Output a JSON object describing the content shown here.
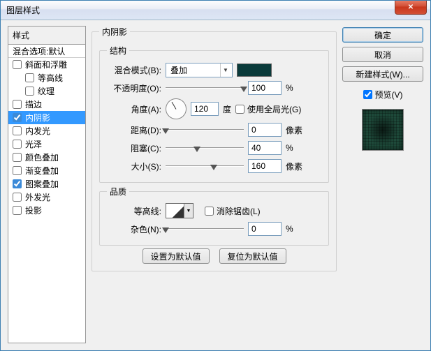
{
  "window": {
    "title": "图层样式",
    "close_glyph": "✕"
  },
  "left": {
    "header": "样式",
    "blend_default": "混合选项:默认",
    "items": [
      {
        "label": "斜面和浮雕",
        "checked": false,
        "indent": false
      },
      {
        "label": "等高线",
        "checked": false,
        "indent": true
      },
      {
        "label": "纹理",
        "checked": false,
        "indent": true
      },
      {
        "label": "描边",
        "checked": false,
        "indent": false
      },
      {
        "label": "内阴影",
        "checked": true,
        "indent": false,
        "selected": true
      },
      {
        "label": "内发光",
        "checked": false,
        "indent": false
      },
      {
        "label": "光泽",
        "checked": false,
        "indent": false
      },
      {
        "label": "颜色叠加",
        "checked": false,
        "indent": false
      },
      {
        "label": "渐变叠加",
        "checked": false,
        "indent": false
      },
      {
        "label": "图案叠加",
        "checked": true,
        "indent": false
      },
      {
        "label": "外发光",
        "checked": false,
        "indent": false
      },
      {
        "label": "投影",
        "checked": false,
        "indent": false
      }
    ]
  },
  "center": {
    "group_title": "内阴影",
    "structure": {
      "title": "结构",
      "blend_mode_label": "混合模式(B):",
      "blend_mode_value": "叠加",
      "color": "#0a3a3a",
      "opacity_label": "不透明度(O):",
      "opacity_value": "100",
      "opacity_unit": "%",
      "angle_label": "角度(A):",
      "angle_value": "120",
      "angle_unit": "度",
      "global_light_label": "使用全局光(G)",
      "global_light_checked": false,
      "distance_label": "距离(D):",
      "distance_value": "0",
      "distance_unit": "像素",
      "choke_label": "阻塞(C):",
      "choke_value": "40",
      "choke_unit": "%",
      "size_label": "大小(S):",
      "size_value": "160",
      "size_unit": "像素"
    },
    "quality": {
      "title": "品质",
      "contour_label": "等高线:",
      "antialias_label": "消除锯齿(L)",
      "antialias_checked": false,
      "noise_label": "杂色(N):",
      "noise_value": "0",
      "noise_unit": "%"
    },
    "buttons": {
      "make_default": "设置为默认值",
      "reset_default": "复位为默认值"
    }
  },
  "right": {
    "ok": "确定",
    "cancel": "取消",
    "new_style": "新建样式(W)...",
    "preview_label": "预览(V)",
    "preview_checked": true
  }
}
